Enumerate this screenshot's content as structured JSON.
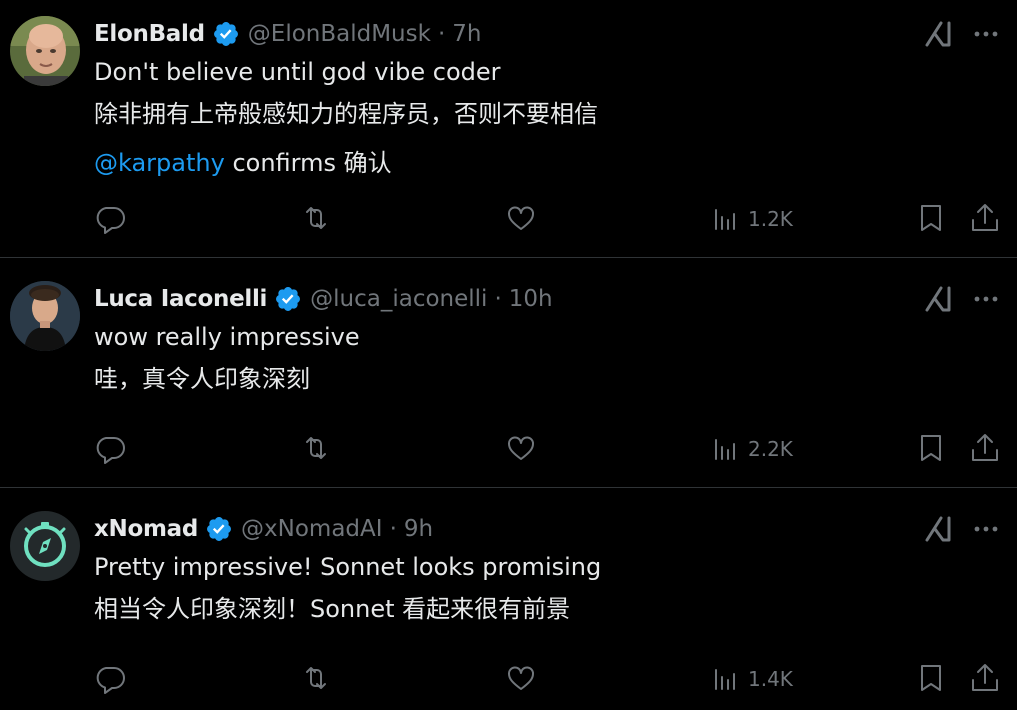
{
  "tweets": [
    {
      "name": "ElonBald",
      "handle": "@ElonBaldMusk",
      "dot": "·",
      "time": "7h",
      "text": "Don't believe until god vibe coder",
      "translation": "除非拥有上帝般感知力的程序员，否则不要相信",
      "mention": "@karpathy",
      "extra_text": " confirms 确认",
      "views": "1.2K",
      "avatar": "bald-man-avatar"
    },
    {
      "name": "Luca Iaconelli",
      "handle": "@luca_iaconelli",
      "dot": "·",
      "time": "10h",
      "text": "wow really impressive",
      "translation": "哇，真令人印象深刻",
      "views": "2.2K",
      "avatar": "man-portrait-avatar"
    },
    {
      "name": "xNomad",
      "handle": "@xNomadAI",
      "dot": "·",
      "time": "9h",
      "text": "Pretty impressive! Sonnet looks promising",
      "translation": "相当令人印象深刻！Sonnet 看起来很有前景",
      "views": "1.4K",
      "avatar": "compass-logo-avatar"
    }
  ],
  "colors": {
    "background": "#000000",
    "text": "#e7e9ea",
    "muted": "#71767b",
    "accent": "#1d9bf0",
    "divider": "#2f3336"
  },
  "icons": [
    "verified-badge-icon",
    "grok-icon",
    "more-icon",
    "reply-icon",
    "retweet-icon",
    "like-icon",
    "views-icon",
    "bookmark-icon",
    "share-icon"
  ]
}
